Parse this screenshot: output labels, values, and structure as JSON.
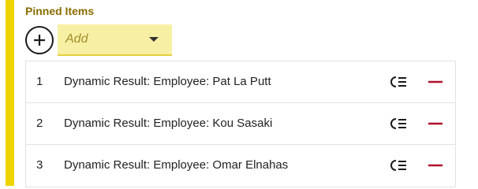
{
  "section": {
    "title": "Pinned Items"
  },
  "add": {
    "placeholder": "Add",
    "icon": "plus-icon",
    "caret_icon": "caret-down-icon"
  },
  "colors": {
    "accent": "#f0d400",
    "title": "#8a6d00",
    "dropdown_bg": "#f7f0a4",
    "remove": "#b0102a"
  },
  "items": [
    {
      "number": "1",
      "label": "Dynamic Result: Employee: Pat La Putt",
      "action_icon": "filter-list-icon",
      "remove_icon": "minus-icon"
    },
    {
      "number": "2",
      "label": "Dynamic Result: Employee: Kou Sasaki",
      "action_icon": "filter-list-icon",
      "remove_icon": "minus-icon"
    },
    {
      "number": "3",
      "label": "Dynamic Result: Employee: Omar Elnahas",
      "action_icon": "filter-list-icon",
      "remove_icon": "minus-icon"
    }
  ]
}
